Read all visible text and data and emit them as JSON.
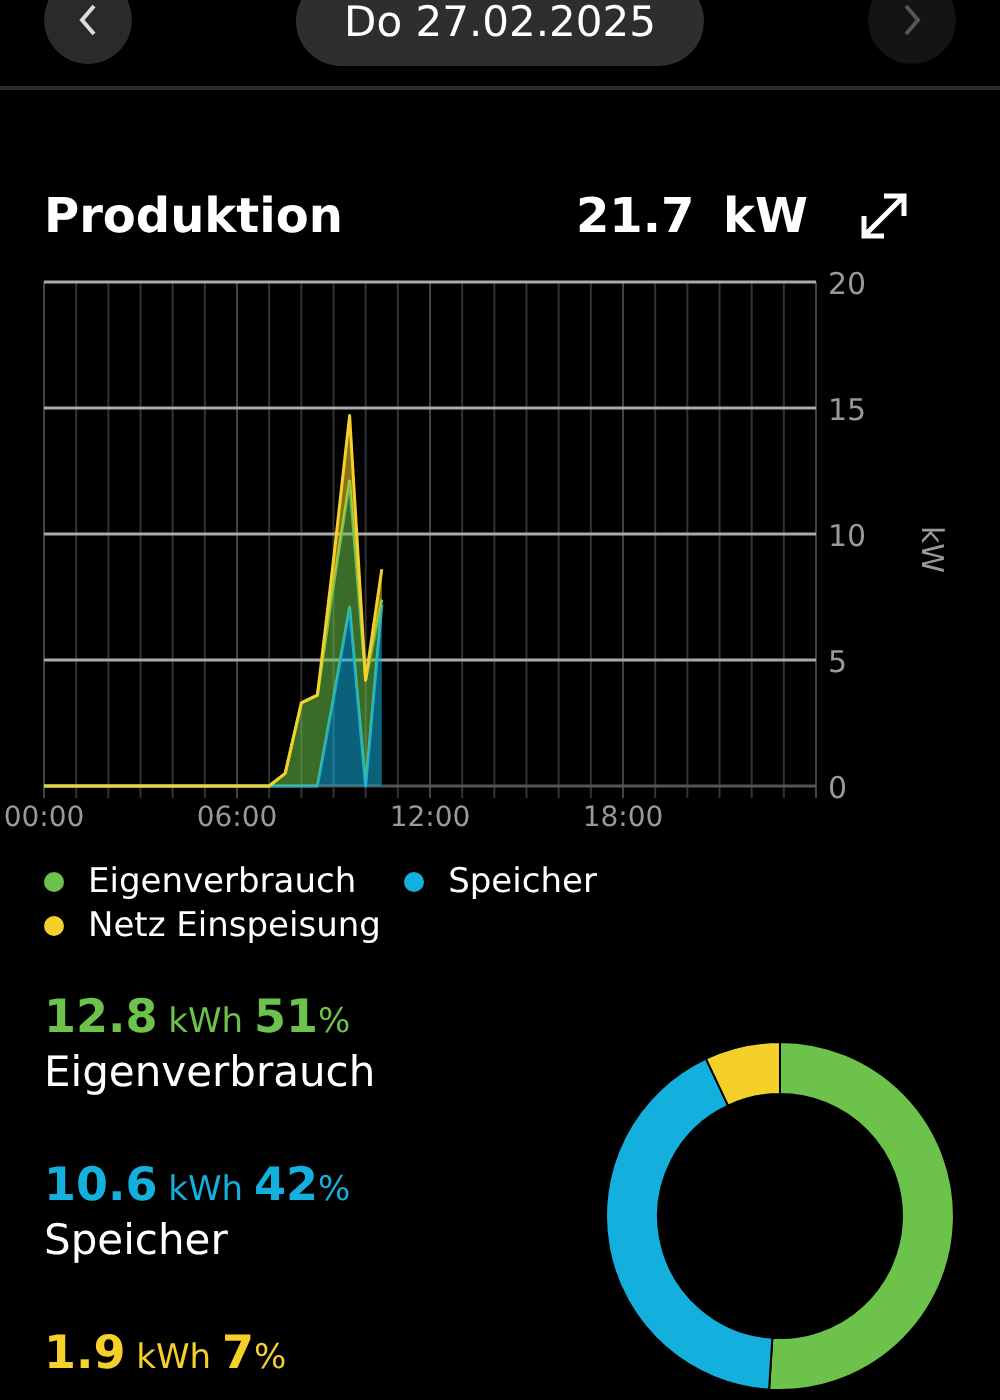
{
  "header": {
    "back_button": {
      "disabled": false
    },
    "date": "Do 27.02.2025",
    "next_button": {
      "disabled": true
    }
  },
  "production": {
    "title": "Produktion",
    "value": "21.7 kW",
    "chart_data": {
      "type": "area",
      "stacked": true,
      "legend": "bottom",
      "grid": true,
      "ylabel": "kW",
      "x": [
        0,
        7,
        7.5,
        8,
        8.5,
        9,
        9.5,
        10,
        10.5
      ],
      "xlim": [
        0,
        24
      ],
      "ylim": [
        0,
        20
      ],
      "xticks": [
        {
          "value": 0,
          "label": "00:00"
        },
        {
          "value": 6,
          "label": "06:00"
        },
        {
          "value": 12,
          "label": "12:00"
        },
        {
          "value": 18,
          "label": "18:00"
        }
      ],
      "yticks": [
        0,
        5,
        10,
        15,
        20
      ],
      "series": [
        {
          "name": "Speicher",
          "color": "#14b0dd",
          "values": [
            0,
            0,
            0,
            0,
            0,
            3.5,
            7.1,
            0,
            7.2
          ]
        },
        {
          "name": "Eigenverbrauch",
          "color": "#6cc24a",
          "values": [
            0,
            0,
            0.5,
            3.3,
            3.6,
            4.5,
            5,
            4.2,
            0.2
          ]
        },
        {
          "name": "Netz Einspeisung",
          "color": "#f5cf2a",
          "values": [
            0,
            0,
            0,
            0,
            0,
            1,
            2.6,
            0,
            1.2
          ]
        }
      ]
    }
  },
  "stats": [
    {
      "amount": "**12.8** kWh **51**%",
      "label": "Eigenverbrauch",
      "color": "#6cc24a"
    },
    {
      "amount": "**10.6** kWh **42**%",
      "label": "Speicher",
      "color": "#14b0dd"
    },
    {
      "amount": "**1.9** kWh **7**%",
      "color": "#f5cf2a"
    }
  ],
  "share_chart": {
    "chart_data": {
      "type": "donut",
      "values": [
        51,
        42,
        7
      ]
    }
  }
}
